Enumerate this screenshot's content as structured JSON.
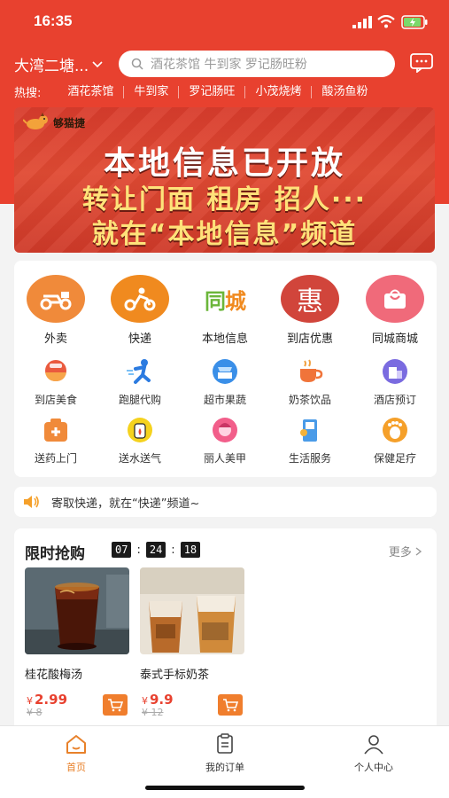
{
  "status": {
    "time": "16:35"
  },
  "header": {
    "location": "大湾二塘...",
    "search_placeholder": "酒花茶馆 牛到家 罗记肠旺粉",
    "hot_label": "热搜:",
    "hot_tags": [
      "酒花茶馆",
      "牛到家",
      "罗记肠旺",
      "小茂烧烤",
      "酸汤鱼粉"
    ]
  },
  "banner": {
    "logo_text": "够猫捷",
    "line1": "本地信息已开放",
    "line2": "转让门面 租房 招人···",
    "line3": "就在“本地信息”频道"
  },
  "categories": {
    "main": [
      {
        "label": "外卖",
        "icon": "delivery-bike-icon"
      },
      {
        "label": "快递",
        "icon": "courier-rider-icon"
      },
      {
        "label": "本地信息",
        "icon": "tongcheng-logo-icon"
      },
      {
        "label": "到店优惠",
        "icon": "hui-discount-icon"
      },
      {
        "label": "同城商城",
        "icon": "shopping-bag-icon"
      }
    ],
    "row2": [
      {
        "label": "到店美食",
        "icon": "food-bowl-icon"
      },
      {
        "label": "跑腿代购",
        "icon": "runner-icon"
      },
      {
        "label": "超市果蔬",
        "icon": "supermarket-icon"
      },
      {
        "label": "奶茶饮品",
        "icon": "tea-cup-icon"
      },
      {
        "label": "酒店预订",
        "icon": "hotel-icon"
      }
    ],
    "row3": [
      {
        "label": "送药上门",
        "icon": "medicine-box-icon"
      },
      {
        "label": "送水送气",
        "icon": "water-gas-icon"
      },
      {
        "label": "丽人美甲",
        "icon": "beauty-icon"
      },
      {
        "label": "生活服务",
        "icon": "life-service-icon"
      },
      {
        "label": "保健足疗",
        "icon": "foot-spa-icon"
      }
    ]
  },
  "notice": {
    "text": "寄取快递，就在“快递”频道~"
  },
  "flash_sale": {
    "title": "限时抢购",
    "countdown": [
      "07",
      "24",
      "18"
    ],
    "more": "更多",
    "products": [
      {
        "name": "桂花酸梅汤",
        "currency": "¥",
        "price": "2.99",
        "old_price": "¥ 8"
      },
      {
        "name": "泰式手标奶茶",
        "currency": "¥",
        "price": "9.9",
        "old_price": "¥ 12"
      }
    ]
  },
  "tabbar": {
    "tabs": [
      {
        "label": "首页",
        "active": true
      },
      {
        "label": "我的订单",
        "active": false
      },
      {
        "label": "个人中心",
        "active": false
      }
    ]
  },
  "colors": {
    "brand_red": "#e8412f",
    "accent_orange": "#f07e2d"
  }
}
